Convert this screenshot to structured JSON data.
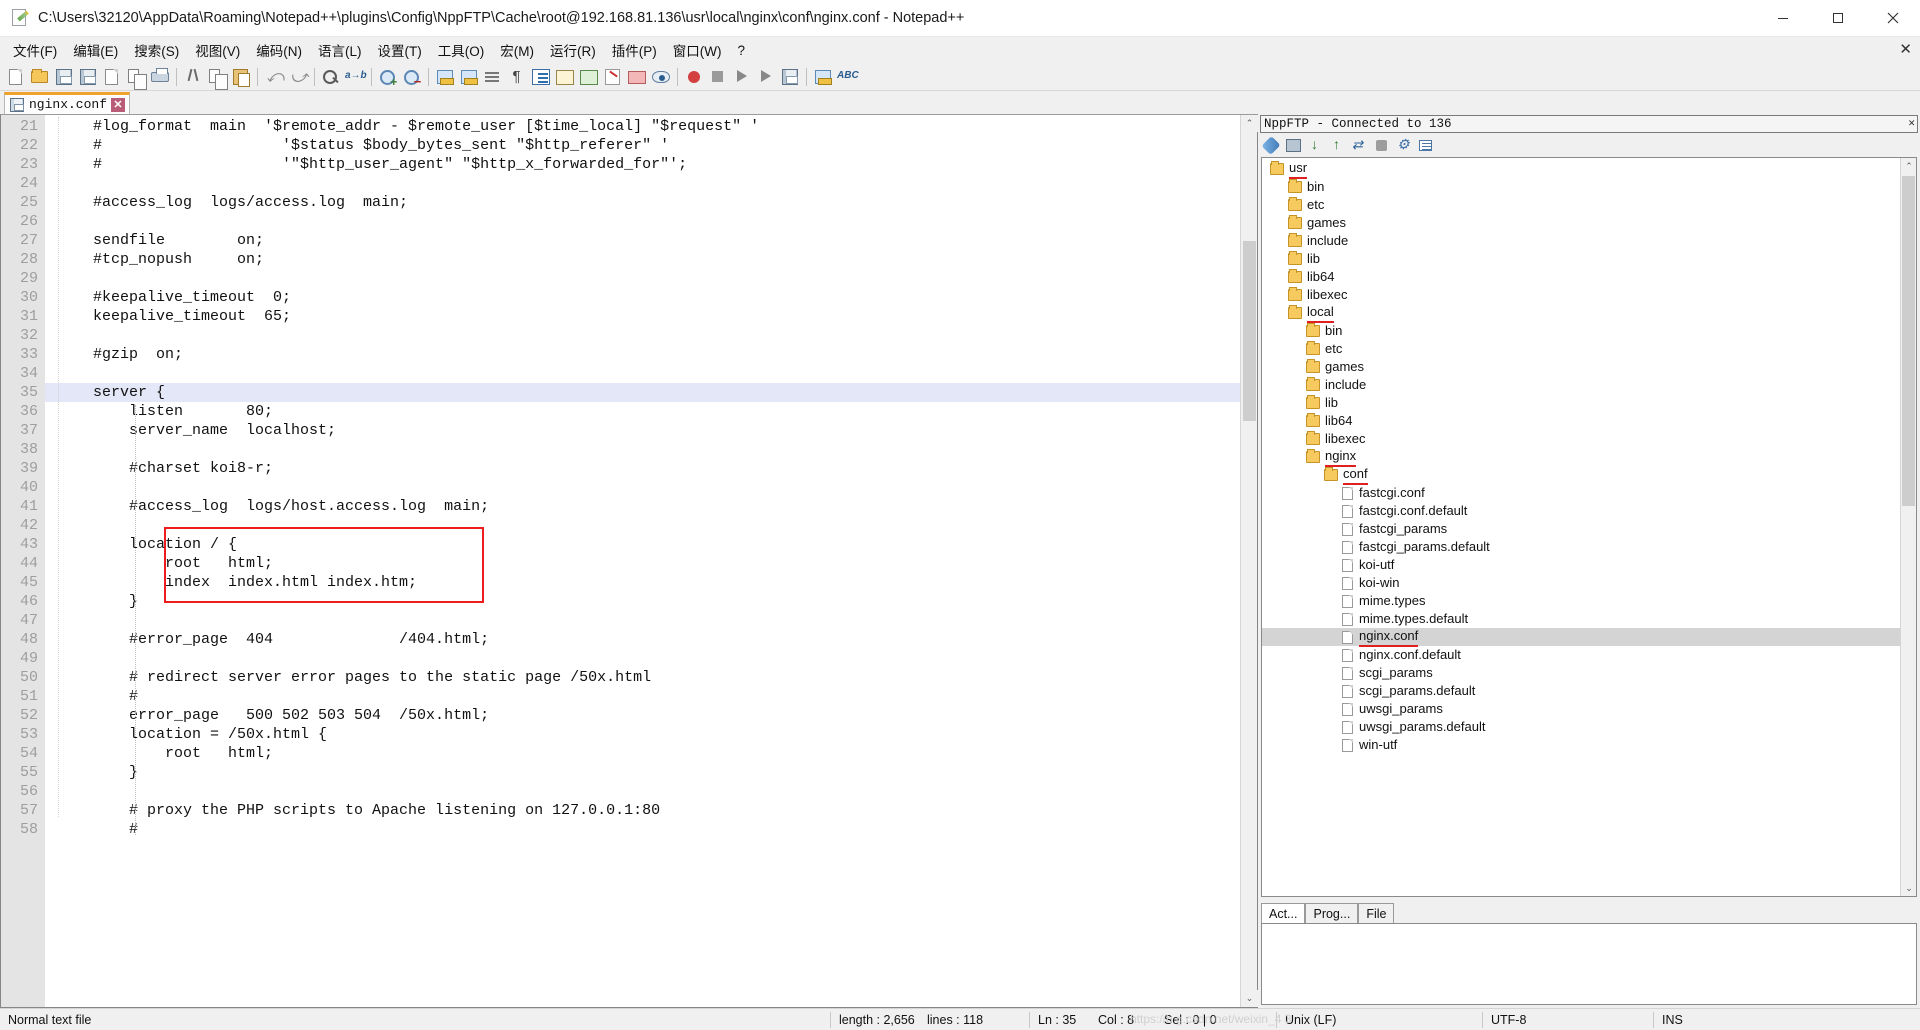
{
  "window": {
    "title": "C:\\Users\\32120\\AppData\\Roaming\\Notepad++\\plugins\\Config\\NppFTP\\Cache\\root@192.168.81.136\\usr\\local\\nginx\\conf\\nginx.conf - Notepad++",
    "icon": "notepad-plus-plus-icon",
    "minimize_label": "—",
    "maximize_label": "▢",
    "close_label": "✕"
  },
  "menubar": {
    "items": [
      "文件(F)",
      "编辑(E)",
      "搜索(S)",
      "视图(V)",
      "编码(N)",
      "语言(L)",
      "设置(T)",
      "工具(O)",
      "宏(M)",
      "运行(R)",
      "插件(P)",
      "窗口(W)",
      "?"
    ],
    "close_label": "✕"
  },
  "toolbar": {
    "icons": [
      "new-file-icon",
      "open-file-icon",
      "save-icon",
      "save-all-icon",
      "close-file-icon",
      "close-all-icon",
      "print-icon",
      "cut-icon",
      "copy-icon",
      "paste-icon",
      "undo-icon",
      "redo-icon",
      "find-icon",
      "replace-icon",
      "zoom-in-icon",
      "zoom-out-icon",
      "sync-vertical-scroll-icon",
      "sync-horizontal-scroll-icon",
      "word-wrap-icon",
      "show-all-characters-icon",
      "indent-guide-icon",
      "user-defined-dialog-icon",
      "document-map-icon",
      "function-list-icon",
      "folder-as-workspace-icon",
      "monitoring-icon",
      "start-record-macro-icon",
      "stop-record-macro-icon",
      "play-macro-icon",
      "run-macro-multiple-icon",
      "save-macro-icon",
      "ftp-icon",
      "spellcheck-icon"
    ]
  },
  "tabbar": {
    "tabs": [
      {
        "label": "nginx.conf",
        "icon": "saved-file-icon",
        "close_label": "✕",
        "active": true
      }
    ]
  },
  "editor": {
    "first_line": 21,
    "current_line": 35,
    "lines": [
      {
        "n": 21,
        "text": "    #log_format  main  '$remote_addr - $remote_user [$time_local] \"$request\" '"
      },
      {
        "n": 22,
        "text": "    #                    '$status $body_bytes_sent \"$http_referer\" '"
      },
      {
        "n": 23,
        "text": "    #                    '\"$http_user_agent\" \"$http_x_forwarded_for\"';"
      },
      {
        "n": 24,
        "text": ""
      },
      {
        "n": 25,
        "text": "    #access_log  logs/access.log  main;"
      },
      {
        "n": 26,
        "text": ""
      },
      {
        "n": 27,
        "text": "    sendfile        on;"
      },
      {
        "n": 28,
        "text": "    #tcp_nopush     on;"
      },
      {
        "n": 29,
        "text": ""
      },
      {
        "n": 30,
        "text": "    #keepalive_timeout  0;"
      },
      {
        "n": 31,
        "text": "    keepalive_timeout  65;"
      },
      {
        "n": 32,
        "text": ""
      },
      {
        "n": 33,
        "text": "    #gzip  on;"
      },
      {
        "n": 34,
        "text": ""
      },
      {
        "n": 35,
        "text": "    server {"
      },
      {
        "n": 36,
        "text": "        listen       80;"
      },
      {
        "n": 37,
        "text": "        server_name  localhost;"
      },
      {
        "n": 38,
        "text": ""
      },
      {
        "n": 39,
        "text": "        #charset koi8-r;"
      },
      {
        "n": 40,
        "text": ""
      },
      {
        "n": 41,
        "text": "        #access_log  logs/host.access.log  main;"
      },
      {
        "n": 42,
        "text": ""
      },
      {
        "n": 43,
        "text": "        location / {"
      },
      {
        "n": 44,
        "text": "            root   html;"
      },
      {
        "n": 45,
        "text": "            index  index.html index.htm;"
      },
      {
        "n": 46,
        "text": "        }"
      },
      {
        "n": 47,
        "text": ""
      },
      {
        "n": 48,
        "text": "        #error_page  404              /404.html;"
      },
      {
        "n": 49,
        "text": ""
      },
      {
        "n": 50,
        "text": "        # redirect server error pages to the static page /50x.html"
      },
      {
        "n": 51,
        "text": "        #"
      },
      {
        "n": 52,
        "text": "        error_page   500 502 503 504  /50x.html;"
      },
      {
        "n": 53,
        "text": "        location = /50x.html {"
      },
      {
        "n": 54,
        "text": "            root   html;"
      },
      {
        "n": 55,
        "text": "        }"
      },
      {
        "n": 56,
        "text": ""
      },
      {
        "n": 57,
        "text": "        # proxy the PHP scripts to Apache listening on 127.0.0.1:80"
      },
      {
        "n": 58,
        "text": "        #"
      }
    ],
    "annotation_box_color": "#ee1c1c",
    "current_line_color": "#e4e7f7",
    "scroll_up_label": "⌃",
    "scroll_down_label": "⌄"
  },
  "ftp": {
    "header_title": "NppFTP - Connected to 136",
    "header_close": "✕",
    "toolbar_icons": [
      "connect-icon",
      "download-icon",
      "upload-icon",
      "refresh-icon",
      "abort-icon",
      "settings-icon",
      "messages-icon"
    ],
    "tree": [
      {
        "label": "usr",
        "type": "folder",
        "depth": 0,
        "underline": true,
        "selected": false
      },
      {
        "label": "bin",
        "type": "folder",
        "depth": 1,
        "underline": false,
        "selected": false
      },
      {
        "label": "etc",
        "type": "folder",
        "depth": 1,
        "underline": false,
        "selected": false
      },
      {
        "label": "games",
        "type": "folder",
        "depth": 1,
        "underline": false,
        "selected": false
      },
      {
        "label": "include",
        "type": "folder",
        "depth": 1,
        "underline": false,
        "selected": false
      },
      {
        "label": "lib",
        "type": "folder",
        "depth": 1,
        "underline": false,
        "selected": false
      },
      {
        "label": "lib64",
        "type": "folder",
        "depth": 1,
        "underline": false,
        "selected": false
      },
      {
        "label": "libexec",
        "type": "folder",
        "depth": 1,
        "underline": false,
        "selected": false
      },
      {
        "label": "local",
        "type": "folder",
        "depth": 1,
        "underline": true,
        "selected": false
      },
      {
        "label": "bin",
        "type": "folder",
        "depth": 2,
        "underline": false,
        "selected": false
      },
      {
        "label": "etc",
        "type": "folder",
        "depth": 2,
        "underline": false,
        "selected": false
      },
      {
        "label": "games",
        "type": "folder",
        "depth": 2,
        "underline": false,
        "selected": false
      },
      {
        "label": "include",
        "type": "folder",
        "depth": 2,
        "underline": false,
        "selected": false
      },
      {
        "label": "lib",
        "type": "folder",
        "depth": 2,
        "underline": false,
        "selected": false
      },
      {
        "label": "lib64",
        "type": "folder",
        "depth": 2,
        "underline": false,
        "selected": false
      },
      {
        "label": "libexec",
        "type": "folder",
        "depth": 2,
        "underline": false,
        "selected": false
      },
      {
        "label": "nginx",
        "type": "folder",
        "depth": 2,
        "underline": true,
        "selected": false
      },
      {
        "label": "conf",
        "type": "folder",
        "depth": 3,
        "underline": true,
        "selected": false
      },
      {
        "label": "fastcgi.conf",
        "type": "file",
        "depth": 4,
        "underline": false,
        "selected": false
      },
      {
        "label": "fastcgi.conf.default",
        "type": "file",
        "depth": 4,
        "underline": false,
        "selected": false
      },
      {
        "label": "fastcgi_params",
        "type": "file",
        "depth": 4,
        "underline": false,
        "selected": false
      },
      {
        "label": "fastcgi_params.default",
        "type": "file",
        "depth": 4,
        "underline": false,
        "selected": false
      },
      {
        "label": "koi-utf",
        "type": "file",
        "depth": 4,
        "underline": false,
        "selected": false
      },
      {
        "label": "koi-win",
        "type": "file",
        "depth": 4,
        "underline": false,
        "selected": false
      },
      {
        "label": "mime.types",
        "type": "file",
        "depth": 4,
        "underline": false,
        "selected": false
      },
      {
        "label": "mime.types.default",
        "type": "file",
        "depth": 4,
        "underline": false,
        "selected": false
      },
      {
        "label": "nginx.conf",
        "type": "file",
        "depth": 4,
        "underline": true,
        "selected": true
      },
      {
        "label": "nginx.conf.default",
        "type": "file",
        "depth": 4,
        "underline": false,
        "selected": false
      },
      {
        "label": "scgi_params",
        "type": "file",
        "depth": 4,
        "underline": false,
        "selected": false
      },
      {
        "label": "scgi_params.default",
        "type": "file",
        "depth": 4,
        "underline": false,
        "selected": false
      },
      {
        "label": "uwsgi_params",
        "type": "file",
        "depth": 4,
        "underline": false,
        "selected": false
      },
      {
        "label": "uwsgi_params.default",
        "type": "file",
        "depth": 4,
        "underline": false,
        "selected": false
      },
      {
        "label": "win-utf",
        "type": "file",
        "depth": 4,
        "underline": false,
        "selected": false
      }
    ],
    "tabs": [
      {
        "label": "Act...",
        "active": true
      },
      {
        "label": "Prog...",
        "active": false
      },
      {
        "label": "File",
        "active": false
      }
    ],
    "scroll_up_label": "⌃",
    "scroll_down_label": "⌄"
  },
  "statusbar": {
    "file_type": "Normal text file",
    "length_label": "length : 2,656",
    "lines_label": "lines : 118",
    "ln": "Ln : 35",
    "col": "Col : 8",
    "sel": "Sel : 0 | 0",
    "eol": "Unix (LF)",
    "encoding": "UTF-8",
    "insert_mode": "INS",
    "watermark": "https://b   g.csdn.net/weixin_4       3"
  }
}
